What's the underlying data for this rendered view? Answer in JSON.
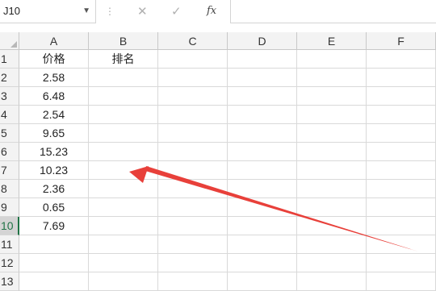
{
  "formula_bar": {
    "name_box": "J10",
    "separator": "⋮",
    "cancel_symbol": "✕",
    "enter_symbol": "✓",
    "fx_label": "fx",
    "formula": ""
  },
  "columns": [
    "A",
    "B",
    "C",
    "D",
    "E",
    "F"
  ],
  "rows": [
    "1",
    "2",
    "3",
    "4",
    "5",
    "6",
    "7",
    "8",
    "9",
    "10",
    "11",
    "12",
    "13"
  ],
  "cells": {
    "A1": "价格",
    "B1": "排名",
    "A2": "2.58",
    "A3": "6.48",
    "A4": "2.54",
    "A5": "9.65",
    "A6": "15.23",
    "A7": "10.23",
    "A8": "2.36",
    "A9": "0.65",
    "A10": "7.69"
  },
  "active_cell": "J10",
  "annotation": {
    "type": "arrow",
    "color": "#e8403a"
  }
}
